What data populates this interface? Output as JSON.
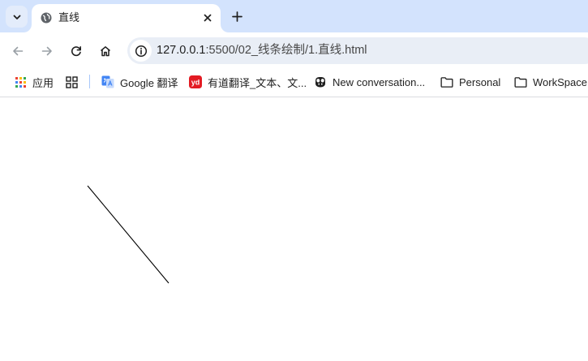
{
  "tab": {
    "title": "直线"
  },
  "toolbar": {
    "url_host": "127.0.0.1",
    "url_path": ":5500/02_线条绘制/1.直线.html"
  },
  "bookmarks": [
    {
      "label": "应用",
      "icon": "apps-grid-icon"
    },
    {
      "label": "",
      "icon": "tab-groups-icon"
    },
    {
      "label": "Google 翻译",
      "icon": "google-translate-icon"
    },
    {
      "label": "有道翻译_文本、文...",
      "icon": "youdao-icon"
    },
    {
      "label": "New conversation...",
      "icon": "copilot-icon"
    },
    {
      "label": "Personal",
      "icon": "folder-icon"
    },
    {
      "label": "WorkSpace",
      "icon": "folder-icon"
    }
  ],
  "canvas_line": {
    "stroke_color": "#000000"
  }
}
